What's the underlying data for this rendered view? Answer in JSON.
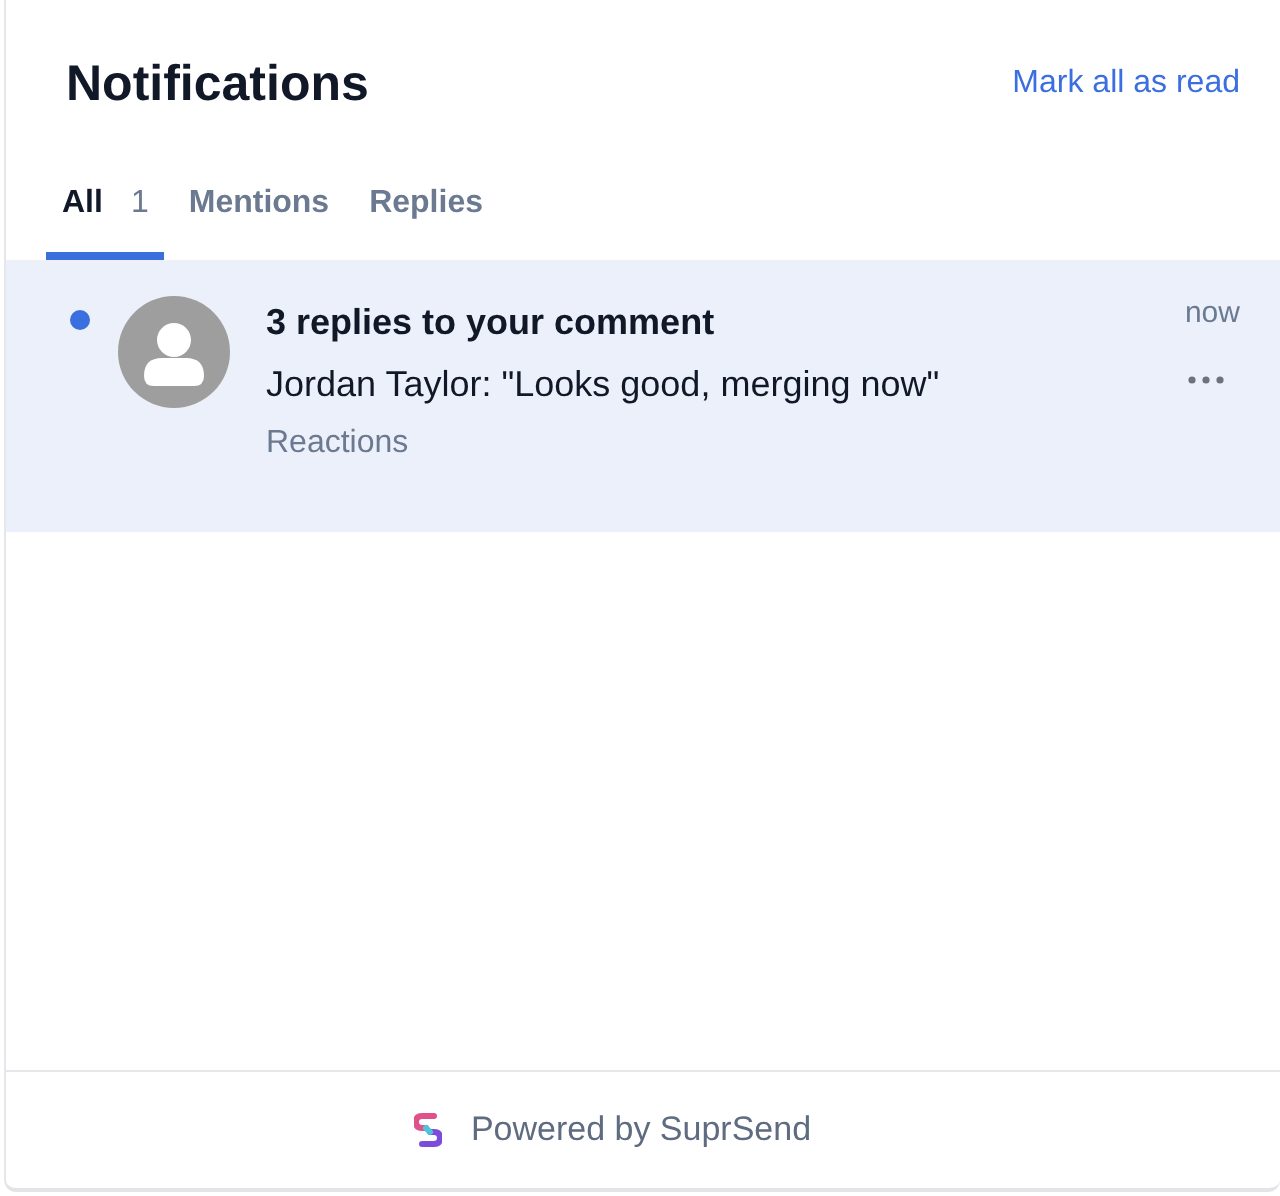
{
  "header": {
    "title": "Notifications",
    "action": "Mark all as read"
  },
  "tabs": [
    {
      "label": "All",
      "count": "1",
      "selected": true
    },
    {
      "label": "Mentions",
      "selected": false
    },
    {
      "label": "Replies",
      "selected": false
    }
  ],
  "notifications": [
    {
      "title": "3 replies to your comment",
      "body": "Jordan Taylor: \"Looks good, merging now\"",
      "subtext": "Reactions",
      "time": "now",
      "unread": true
    }
  ],
  "footer": {
    "text": "Powered by SuprSend"
  }
}
